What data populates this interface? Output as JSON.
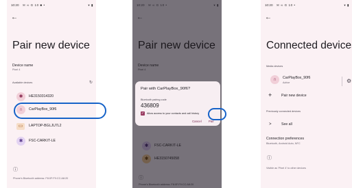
{
  "panel1": {
    "status": {
      "time": "10:20",
      "icons": "✉ ∞ G 10 ■ •",
      "right": "▾ ▮"
    },
    "back_icon": "arrow-back-icon",
    "title": "Pair new device",
    "device_name_label": "Device name",
    "device_name_value": "Pixel 4",
    "available_devices_label": "Available devices",
    "devices": [
      {
        "name": "HE3150314320",
        "icon": "bluetooth-icon"
      },
      {
        "name": "CarPlayBox_90f6",
        "icon": "headphones-icon"
      },
      {
        "name": "LAPTOP-BGLJU7L2",
        "icon": "laptop-icon"
      },
      {
        "name": "FSC-CARKIT-LE",
        "icon": "bluetooth-icon"
      }
    ],
    "footer": "Phone's Bluetooth address: F8:0F:F9:CC:A8:20"
  },
  "panel2": {
    "status": {
      "time": "10:20",
      "icons": "✉ ∞ G 10 •",
      "right": "▾ ▮"
    },
    "title": "Pair new device",
    "device_name_label": "Device name",
    "device_name_value": "Pixel 4",
    "available_devices_label": "Available devices",
    "dialog": {
      "title": "Pair with CarPlayBox_90f6?",
      "code_label": "Bluetooth pairing code",
      "code": "436809",
      "checkbox_label": "Allow access to your contacts and call history",
      "cancel": "Cancel",
      "pair": "Pair"
    },
    "devices": [
      {
        "name": "FSC-CARKIT-LE",
        "icon": "bluetooth-icon"
      },
      {
        "name": "HE3150745058",
        "icon": "bluetooth-icon"
      }
    ],
    "footer": "Phone's Bluetooth address: F8:0F:F9:CC:A8:20"
  },
  "panel3": {
    "status": {
      "time": "10:20",
      "icons": "✉ ∞ G 10 •",
      "right": "▾ ▮"
    },
    "title": "Connected devices",
    "media_label": "Media devices",
    "media_device": {
      "name": "CarPlayBox_90f6",
      "status": "Active"
    },
    "pair_new": "Pair new device",
    "previous_label": "Previously connected devices",
    "see_all": "See all",
    "prefs_title": "Connection preferences",
    "prefs_sub": "Bluetooth, Android Auto, NFC",
    "visible_text": "Visible as 'Pixel 4' to other devices"
  }
}
